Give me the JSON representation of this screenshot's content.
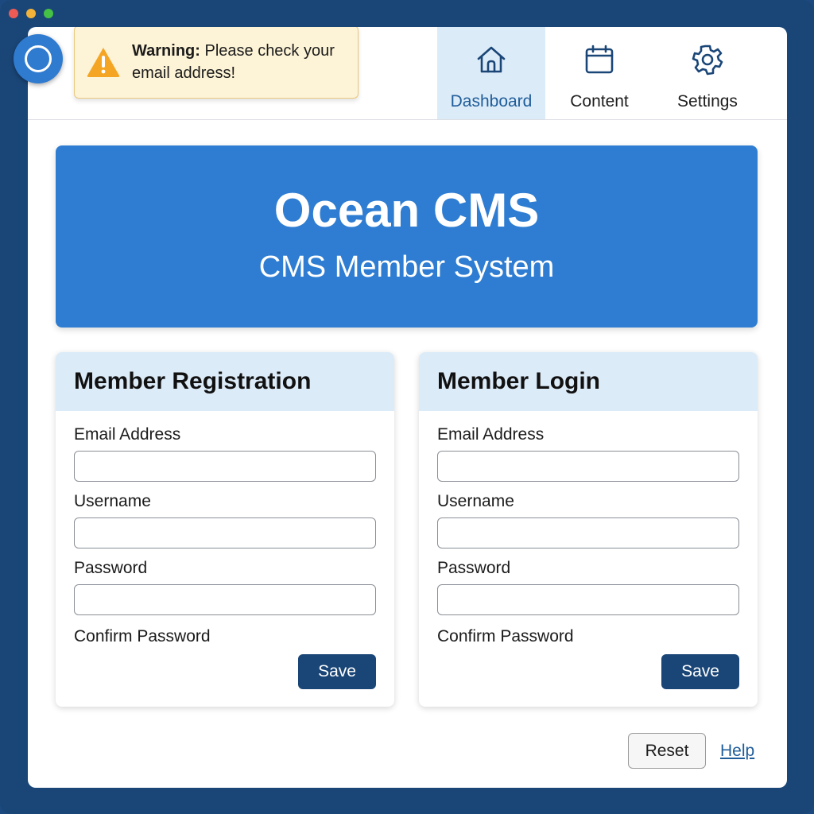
{
  "warning": {
    "bold": "Warning:",
    "text": " Please check your email address!"
  },
  "nav": {
    "items": [
      {
        "label": "Dashboard",
        "icon": "home-icon",
        "active": true
      },
      {
        "label": "Content",
        "icon": "calendar-icon",
        "active": false
      },
      {
        "label": "Settings",
        "icon": "gear-icon",
        "active": false
      }
    ]
  },
  "hero": {
    "title": "Ocean CMS",
    "subtitle": "CMS Member System"
  },
  "registration": {
    "title": "Member Registration",
    "email_label": "Email Address",
    "email_value": "",
    "username_label": "Username",
    "username_value": "",
    "password_label": "Password",
    "password_value": "",
    "confirm_label": "Confirm Password",
    "save_label": "Save"
  },
  "login": {
    "title": "Member Login",
    "email_label": "Email Address",
    "email_value": "",
    "username_label": "Username",
    "username_value": "",
    "password_label": "Password",
    "password_value": "",
    "confirm_label": "Confirm Password",
    "save_label": "Save"
  },
  "footer": {
    "reset_label": "Reset",
    "help_label": "Help"
  },
  "colors": {
    "frame": "#1a4677",
    "accent": "#2e7dd2",
    "nav_active": "#dcebf8",
    "warning_bg": "#fdf3d6",
    "button_dark": "#1a4677"
  }
}
